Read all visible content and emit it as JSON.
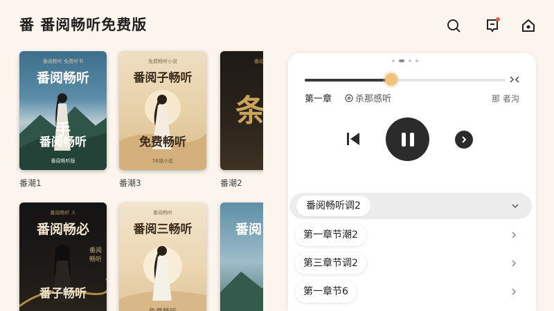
{
  "app": {
    "icon_glyph": "番",
    "title": "番阅畅听免费版",
    "header_icons": [
      "search-icon",
      "notification-icon",
      "home-icon"
    ]
  },
  "books": [
    {
      "label": "番潮1",
      "cover": {
        "title": "番阅畅听",
        "subtitle": "番阅畅听",
        "glyph": "手",
        "top_text": "番阅畅听 免费听书",
        "publisher": "番阅畅听版",
        "theme": "blue"
      }
    },
    {
      "label": "番潮3",
      "cover": {
        "title": "番阅子畅听",
        "subtitle": "免费畅听",
        "top_text": "免费畅听小说",
        "publisher": "58道小说",
        "theme": "beige"
      }
    },
    {
      "label": "番潮2",
      "cover": {
        "title": "",
        "subtitle": "",
        "glyph": "条",
        "top_text": "番阅畅听",
        "publisher": "",
        "theme": "dark-partial"
      }
    },
    {
      "label": "",
      "cover": {
        "title": "番阅畅必",
        "subtitle": "番子畅听",
        "top_text": "番阅畅听 人",
        "side_text": "番阅畅听",
        "publisher": "",
        "theme": "black"
      }
    },
    {
      "label": "",
      "cover": {
        "title": "番阅三畅听",
        "subtitle": "",
        "top_text": "番阅畅听",
        "publisher": "免费畅听",
        "theme": "cream"
      }
    },
    {
      "label": "",
      "cover": {
        "title": "番阅",
        "subtitle": "",
        "top_text": "",
        "publisher": "",
        "theme": "blue-partial"
      }
    }
  ],
  "player": {
    "progress": 0.43,
    "chapter": "第一章",
    "timer_label": "杀那感听",
    "narrator": "那 者沟",
    "controls": [
      "previous-icon",
      "pause-icon",
      "next-icon"
    ]
  },
  "chapters": {
    "current": "番阅畅听调2",
    "items": [
      {
        "label": "第一章节潮2"
      },
      {
        "label": "第三章节调2"
      },
      {
        "label": "第一章节6"
      }
    ]
  },
  "colors": {
    "background": "#fbf5ee",
    "panel": "#ffffff",
    "slider_thumb": "#f2c27a",
    "control_dark": "#2b2b2b"
  }
}
